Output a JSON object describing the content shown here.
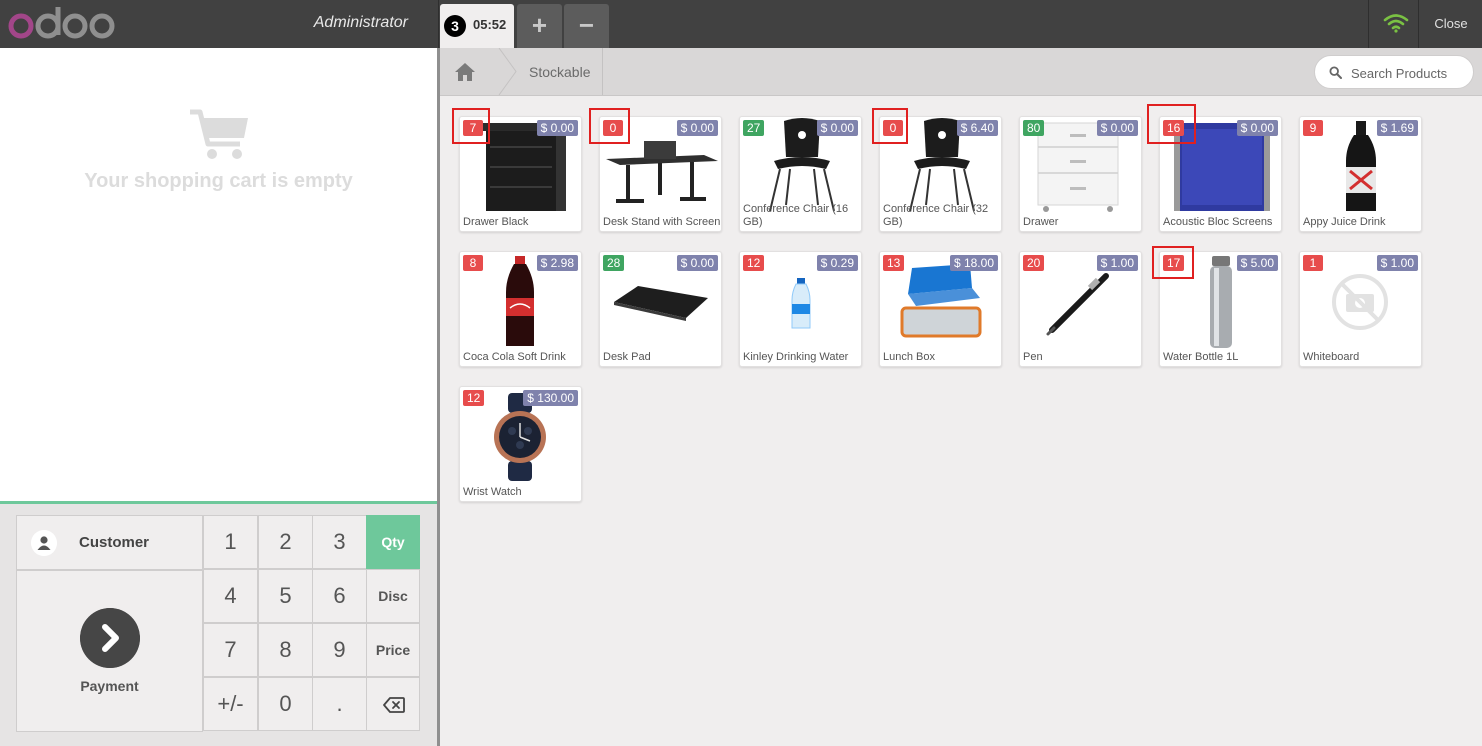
{
  "header": {
    "logo_text": "odoo",
    "cashier": "Administrator",
    "order_tab": {
      "number": "3",
      "time": "05:52"
    },
    "add_order_label": "+",
    "delete_order_label": "−",
    "connection_icon": "wifi-icon",
    "close_label": "Close"
  },
  "cart": {
    "empty_text": "Your shopping cart is empty",
    "icon": "shopping-cart-icon"
  },
  "actionpad": {
    "customer_label": "Customer",
    "payment_label": "Payment"
  },
  "numpad": {
    "keys": [
      "1",
      "2",
      "3",
      "4",
      "5",
      "6",
      "7",
      "8",
      "9",
      "+/-",
      "0",
      "."
    ],
    "modes": [
      "Qty",
      "Disc",
      "Price"
    ],
    "active_mode": "Qty",
    "backspace_icon": "backspace-icon"
  },
  "breadcrumb": {
    "home_icon": "home-icon",
    "category": "Stockable"
  },
  "search": {
    "placeholder": "Search Products"
  },
  "colors": {
    "header_bg": "#414141",
    "accent": "#6ec89b",
    "qty_low": "#e74c4c",
    "qty_ok": "#3fa561",
    "price_tag": "#7f82ac"
  },
  "products": [
    {
      "name": "Drawer Black",
      "qty": "7",
      "price": "$ 0.00",
      "status": "low",
      "highlighted": true
    },
    {
      "name": "Desk Stand with Screen",
      "qty": "0",
      "price": "$ 0.00",
      "status": "low",
      "highlighted": true
    },
    {
      "name": "Conference Chair (16 GB)",
      "qty": "27",
      "price": "$ 0.00",
      "status": "ok",
      "highlighted": false
    },
    {
      "name": "Conference Chair (32 GB)",
      "qty": "0",
      "price": "$ 6.40",
      "status": "low",
      "highlighted": true
    },
    {
      "name": "Drawer",
      "qty": "80",
      "price": "$ 0.00",
      "status": "ok",
      "highlighted": false
    },
    {
      "name": "Acoustic Bloc Screens",
      "qty": "16",
      "price": "$ 0.00",
      "status": "low",
      "highlighted": true
    },
    {
      "name": "Appy Juice Drink",
      "qty": "9",
      "price": "$ 1.69",
      "status": "low",
      "highlighted": false
    },
    {
      "name": "Coca Cola Soft Drink",
      "qty": "8",
      "price": "$ 2.98",
      "status": "low",
      "highlighted": false
    },
    {
      "name": "Desk Pad",
      "qty": "28",
      "price": "$ 0.00",
      "status": "ok",
      "highlighted": false
    },
    {
      "name": "Kinley Drinking Water",
      "qty": "12",
      "price": "$ 0.29",
      "status": "low",
      "highlighted": false
    },
    {
      "name": "Lunch Box",
      "qty": "13",
      "price": "$ 18.00",
      "status": "low",
      "highlighted": false
    },
    {
      "name": "Pen",
      "qty": "20",
      "price": "$ 1.00",
      "status": "low",
      "highlighted": false
    },
    {
      "name": "Water Bottle 1L",
      "qty": "17",
      "price": "$ 5.00",
      "status": "low",
      "highlighted": true
    },
    {
      "name": "Whiteboard",
      "qty": "1",
      "price": "$ 1.00",
      "status": "low",
      "highlighted": false
    },
    {
      "name": "Wrist Watch",
      "qty": "12",
      "price": "$ 130.00",
      "status": "low",
      "highlighted": false
    }
  ]
}
